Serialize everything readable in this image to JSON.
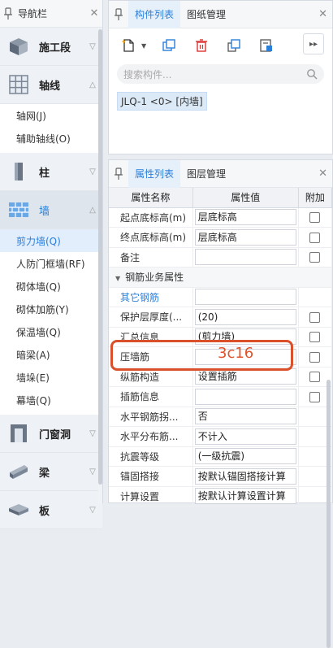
{
  "nav": {
    "title": "导航栏",
    "categories": [
      {
        "label": "施工段",
        "icon": "construction-segment-icon",
        "expanded": false
      },
      {
        "label": "轴线",
        "icon": "grid-axis-icon",
        "expanded": true,
        "items": [
          "轴网(J)",
          "辅助轴线(O)"
        ]
      },
      {
        "label": "柱",
        "icon": "column-icon",
        "expanded": false
      },
      {
        "label": "墙",
        "icon": "wall-icon",
        "expanded": true,
        "active": true,
        "items": [
          "剪力墙(Q)",
          "人防门框墙(RF)",
          "砌体墙(Q)",
          "砌体加筋(Y)",
          "保温墙(Q)",
          "暗梁(A)",
          "墙垛(E)",
          "幕墙(Q)"
        ]
      },
      {
        "label": "门窗洞",
        "icon": "door-window-icon",
        "expanded": false
      },
      {
        "label": "梁",
        "icon": "beam-icon",
        "expanded": false
      },
      {
        "label": "板",
        "icon": "slab-icon",
        "expanded": false
      }
    ],
    "selected_item": "剪力墙(Q)"
  },
  "top_panel": {
    "tabs": [
      "构件列表",
      "图纸管理"
    ],
    "active_tab": "构件列表",
    "toolbar_icons": [
      "new-component-icon",
      "copy-icon",
      "delete-icon",
      "layer-copy-icon",
      "filter-icon",
      "expand-more-icon"
    ],
    "search_placeholder": "搜索构件...",
    "component": "JLQ-1 <0> [内墙]"
  },
  "bottom_panel": {
    "tabs": [
      "属性列表",
      "图层管理"
    ],
    "active_tab": "属性列表",
    "columns": [
      "属性名称",
      "属性值",
      "附加"
    ],
    "rows": [
      {
        "name": "起点底标高(m)",
        "value": "层底标高",
        "checkbox": true
      },
      {
        "name": "终点底标高(m)",
        "value": "层底标高",
        "checkbox": true
      },
      {
        "name": "备注",
        "value": "",
        "checkbox": true
      },
      {
        "group": "钢筋业务属性"
      },
      {
        "name": "其它钢筋",
        "value": "",
        "checkbox": false,
        "link": true
      },
      {
        "name": "保护层厚度(...",
        "value": "(20)",
        "checkbox": true
      },
      {
        "name": "汇总信息",
        "value": "(剪力墙)",
        "checkbox": true
      },
      {
        "name": "压墙筋",
        "value": "",
        "checkbox": true
      },
      {
        "name": "纵筋构造",
        "value": "设置插筋",
        "checkbox": true
      },
      {
        "name": "插筋信息",
        "value": "",
        "checkbox": true
      },
      {
        "name": "水平钢筋拐...",
        "value": "否",
        "checkbox": false
      },
      {
        "name": "水平分布筋...",
        "value": "不计入",
        "checkbox": false
      },
      {
        "name": "抗震等级",
        "value": "(一级抗震)",
        "checkbox": false
      },
      {
        "name": "锚固搭接",
        "value": "按默认锚固搭接计算",
        "checkbox": false
      },
      {
        "name": "计算设置",
        "value": "按默认计算设置计算",
        "checkbox": false
      }
    ]
  },
  "annotation": {
    "text": "3c16",
    "color": "#d9502b"
  },
  "colors": {
    "accent": "#2b7fd9",
    "highlight": "#d9502b"
  }
}
